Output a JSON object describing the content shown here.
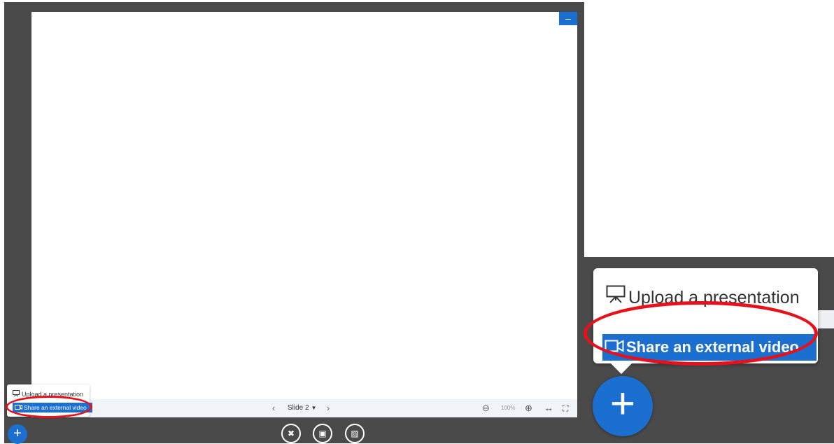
{
  "presentation": {
    "minimize_label": "–",
    "slide_selector": "Slide 2",
    "zoom_level": "100%"
  },
  "toolbar_icons": {
    "prev": "‹",
    "next": "›",
    "zoom_out": "⊖",
    "zoom_in": "⊕",
    "fit_width": "↔",
    "fullscreen": "⛶"
  },
  "action_menu": {
    "upload_label": "Upload a presentation",
    "share_label": "Share an external video",
    "plus_label": "+"
  },
  "media_buttons": {
    "hide_presentation_label": "✖",
    "share_webcam_label": "▣",
    "share_screen_label": "▨"
  },
  "colors": {
    "accent": "#1b6fd1",
    "dark_background": "#4a4a4a",
    "highlight": "#e6111b"
  },
  "icons": {
    "upload": "presentation-board-icon",
    "share": "video-camera-icon"
  }
}
